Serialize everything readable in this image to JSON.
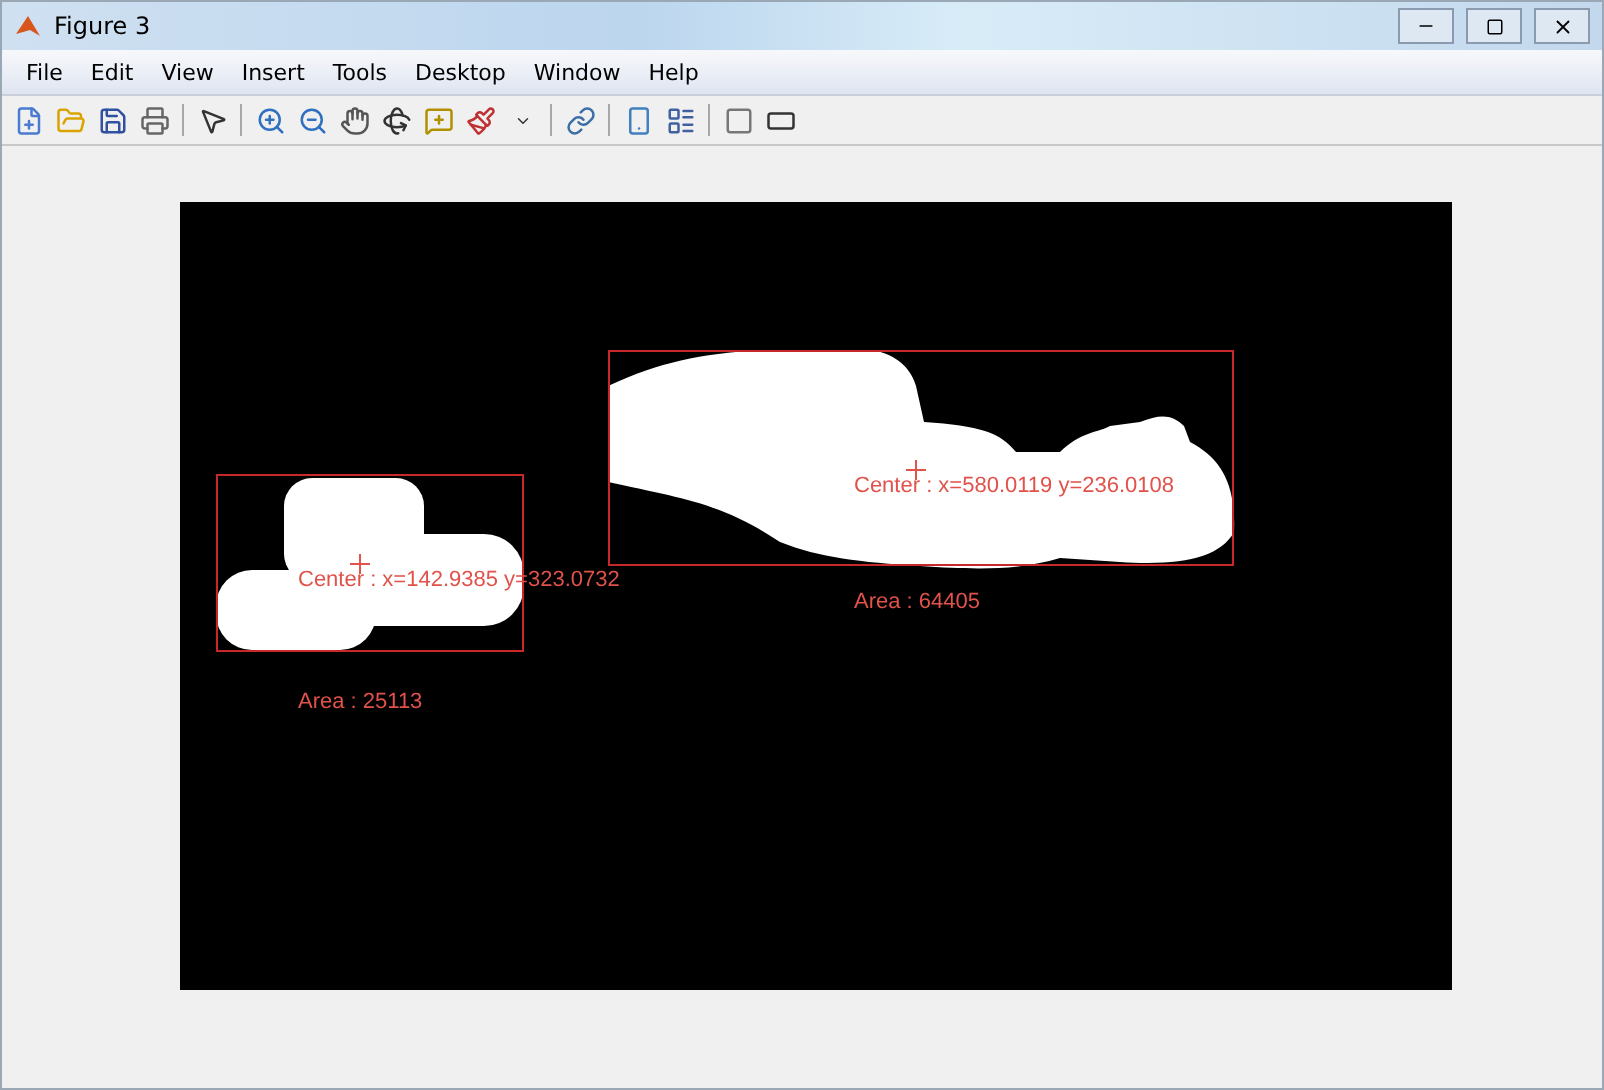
{
  "window": {
    "title": "Figure 3"
  },
  "menu": [
    "File",
    "Edit",
    "View",
    "Insert",
    "Tools",
    "Desktop",
    "Window",
    "Help"
  ],
  "regions": [
    {
      "center_label": "Center : x=142.9385 y=323.0732",
      "area_label": "Area : 25113"
    },
    {
      "center_label": "Center : x=580.0119 y=236.0108",
      "area_label": "Area : 64405"
    }
  ]
}
